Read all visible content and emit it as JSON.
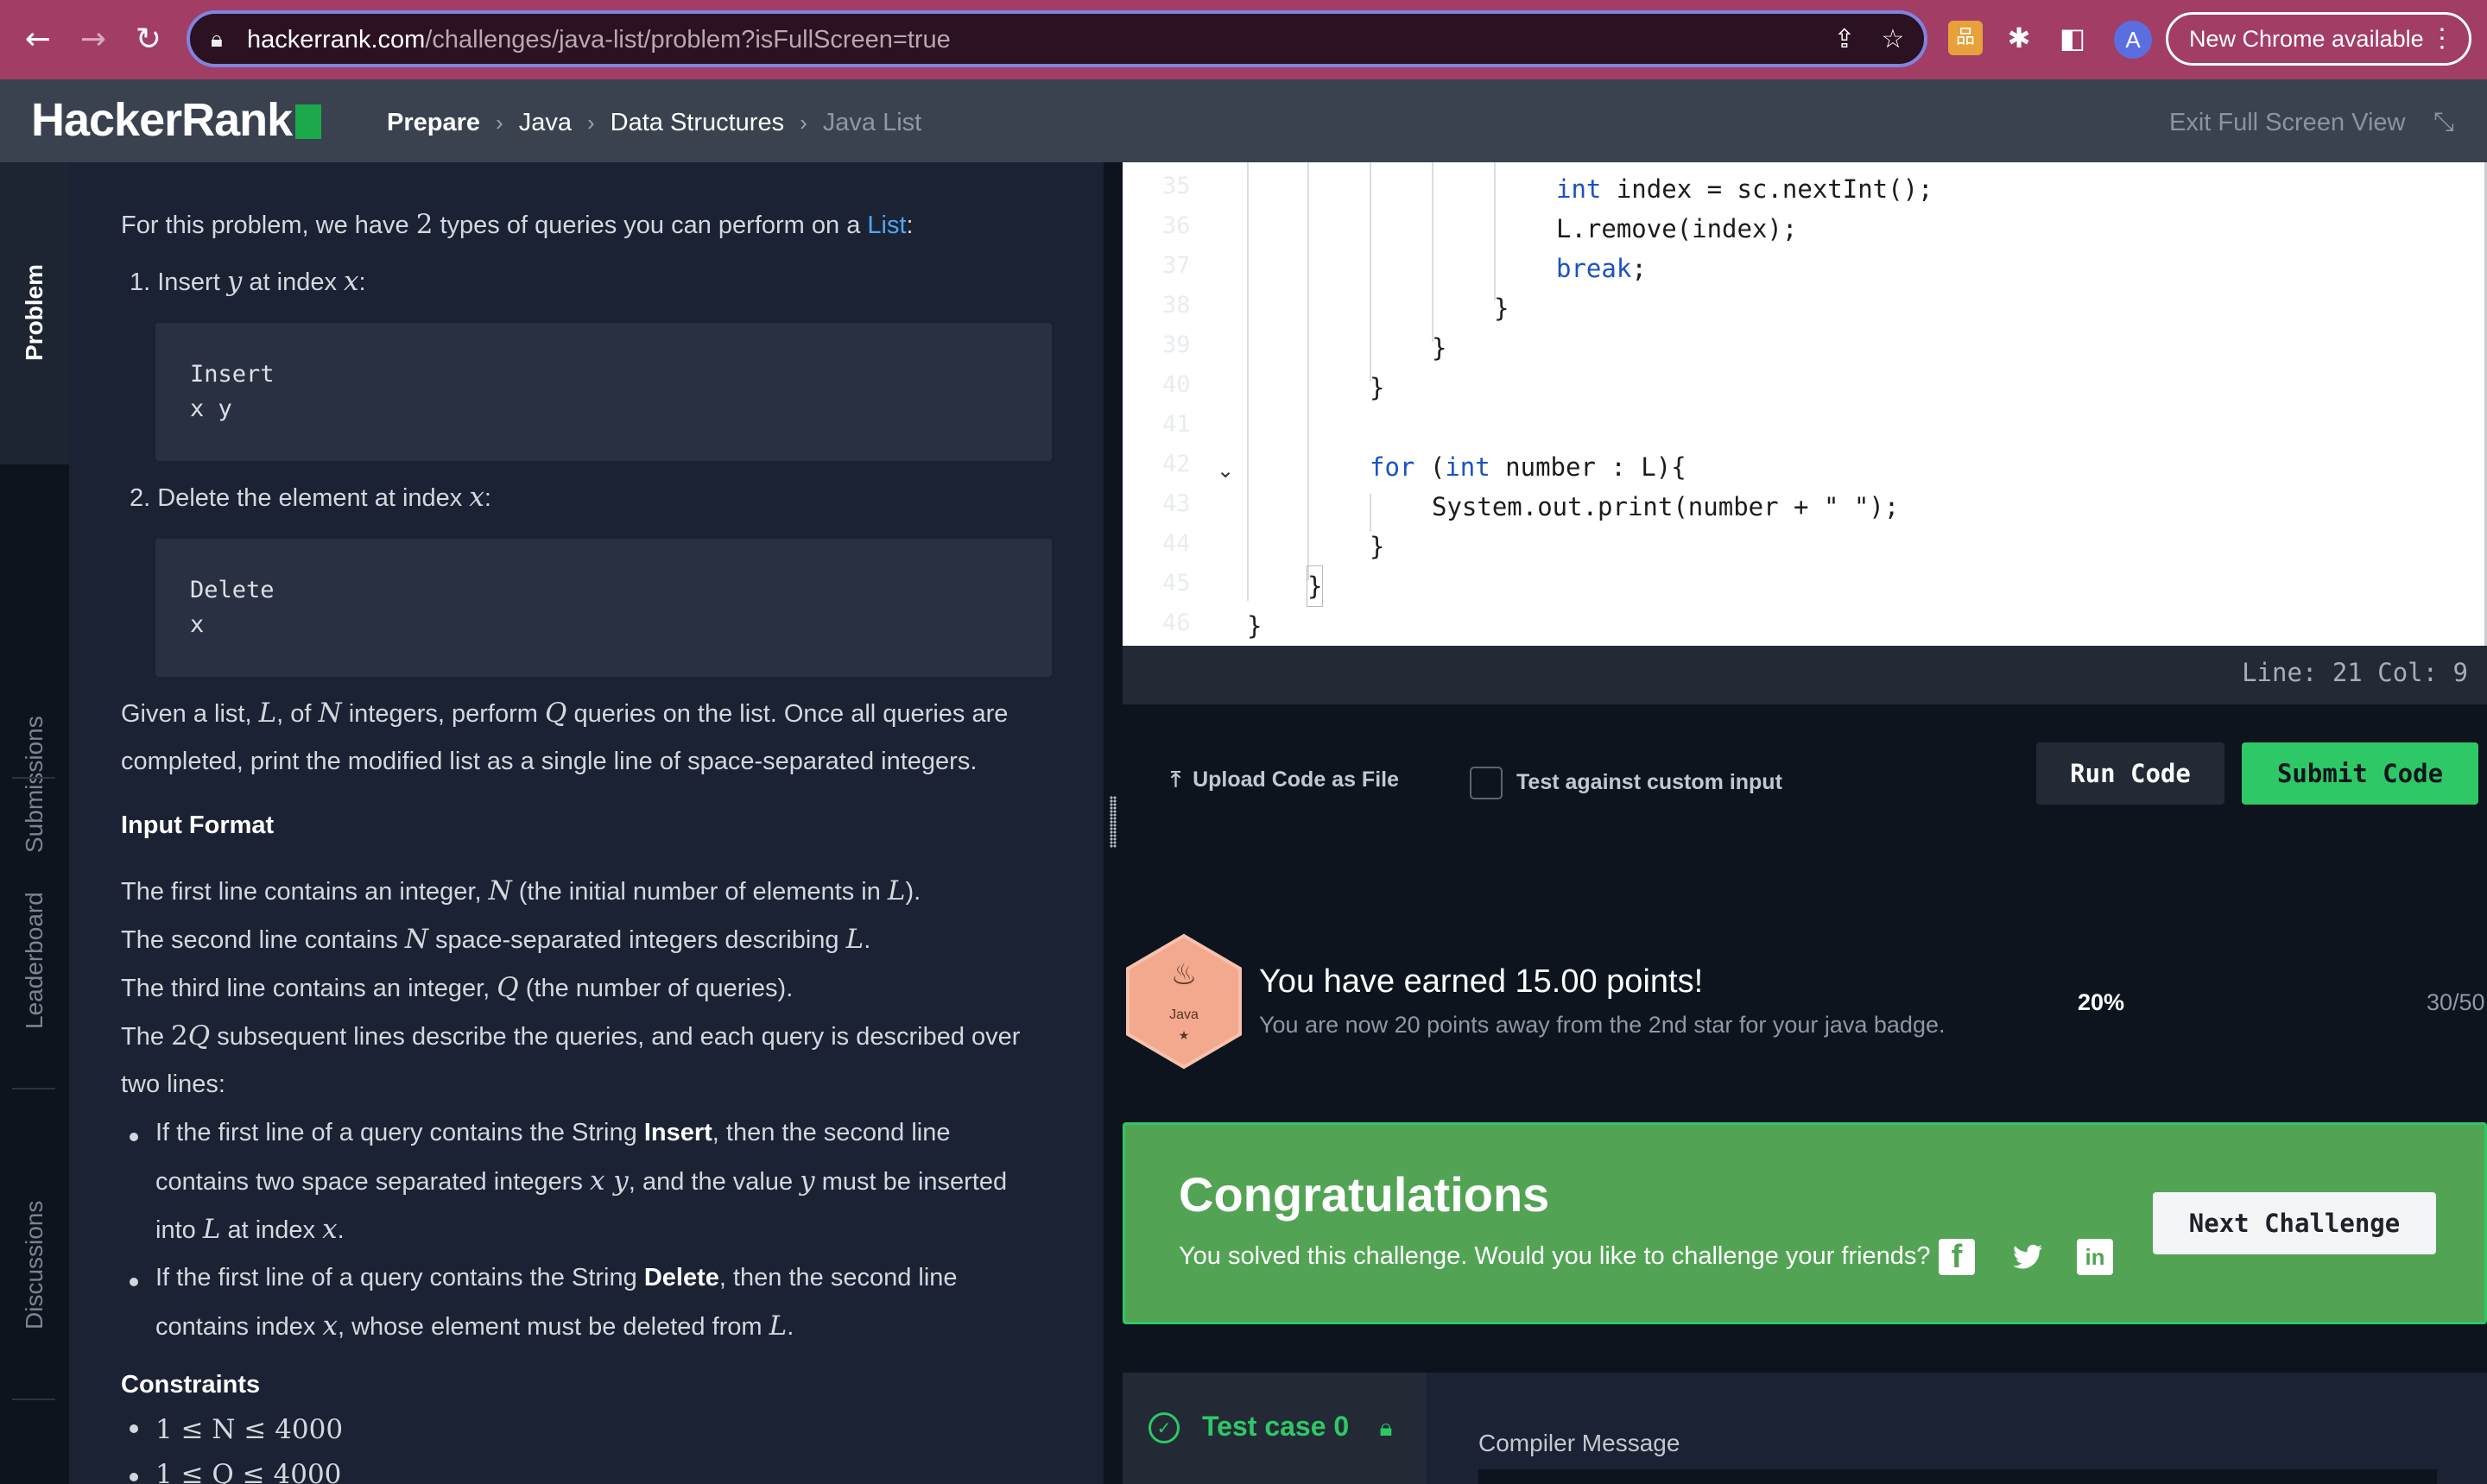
{
  "browser": {
    "url_host": "hackerrank.com",
    "url_path": "/challenges/java-list/problem?isFullScreen=true",
    "avatar_letter": "A",
    "new_chrome_label": "New Chrome available",
    "extension_label": "品",
    "accent_color": "#a23d65"
  },
  "header": {
    "logo": "HackerRank",
    "breadcrumb": [
      "Prepare",
      "Java",
      "Data Structures",
      "Java List"
    ],
    "exit_full_screen": "Exit Full Screen View"
  },
  "vertical_tabs": [
    "Problem",
    "Submissions",
    "Leaderboard",
    "Discussions"
  ],
  "problem": {
    "intro_a": "For this problem, we have ",
    "intro_num": "2",
    "intro_b": " types of queries you can perform on a ",
    "intro_link": "List",
    "intro_c": ":",
    "q1_a": "1. Insert ",
    "q1_var1": "y",
    "q1_b": " at index ",
    "q1_var2": "x",
    "q1_c": ":",
    "code1_line1": "Insert",
    "code1_line2": "x y",
    "q2_a": "2. Delete the element at index ",
    "q2_var": "x",
    "q2_b": ":",
    "code2_line1": "Delete",
    "code2_line2": "x",
    "given_a": "Given a list, ",
    "given_L": "L",
    "given_b": ", of ",
    "given_N": "N",
    "given_c": " integers, perform ",
    "given_Q": "Q",
    "given_d": " queries on the list. Once all queries are",
    "given_line2": "completed, print the modified list as a single line of space-separated integers.",
    "input_format_heading": "Input Format",
    "if1_a": "The first line contains an integer, ",
    "if1_N": "N",
    "if1_b": " (the initial number of elements in ",
    "if1_L": "L",
    "if1_c": ").",
    "if2_a": "The second line contains ",
    "if2_N": "N",
    "if2_b": " space-separated integers describing ",
    "if2_L": "L",
    "if2_c": ".",
    "if3_a": "The third line contains an integer, ",
    "if3_Q": "Q",
    "if3_b": " (the number of queries).",
    "if4_a": "The ",
    "if4_2": "2",
    "if4_Q": "Q",
    "if4_b": " subsequent lines describe the queries, and each query is described over",
    "if4_line2": "two lines:",
    "b1_a": "If the first line of a query contains the String ",
    "b1_bold": "Insert",
    "b1_b": ", then the second line",
    "b1_l2a": "contains two space separated integers ",
    "b1_xy": "x y",
    "b1_l2b": ", and the value ",
    "b1_y": "y",
    "b1_l2c": " must be inserted",
    "b1_l3a": "into ",
    "b1_L": "L",
    "b1_l3b": " at index ",
    "b1_x": "x",
    "b1_l3c": ".",
    "b2_a": "If the first line of a query contains the String ",
    "b2_bold": "Delete",
    "b2_b": ", then the second line",
    "b2_l2a": "contains index ",
    "b2_x": "x",
    "b2_l2b": ", whose element must be deleted from ",
    "b2_L": "L",
    "b2_l2c": ".",
    "constraints_heading": "Constraints",
    "c1": "1 ≤ N ≤ 4000",
    "c2": "1 ≤ Q ≤ 4000"
  },
  "editor": {
    "line_numbers": [
      "35",
      "36",
      "37",
      "38",
      "39",
      "40",
      "41",
      "42",
      "43",
      "44",
      "45",
      "46"
    ],
    "lines": {
      "l35": "int index = sc.nextInt();",
      "l35_kw": "int",
      "l35_rest": " index = sc.nextInt();",
      "l36": "L.remove(index);",
      "l37_kw": "break",
      "l37_rest": ";",
      "l38": "}",
      "l39": "}",
      "l40": "}",
      "l42_kw1": "for",
      "l42_a": " (",
      "l42_kw2": "int",
      "l42_b": " number : L){",
      "l43": "System.out.print(number + \" \");",
      "l44": "}",
      "l45": "}",
      "l46": "}"
    },
    "cursor_position": "Line: 21 Col: 9"
  },
  "actions": {
    "upload_label": "Upload Code as File",
    "custom_input_label": "Test against custom input",
    "run_label": "Run Code",
    "submit_label": "Submit Code"
  },
  "points": {
    "badge_label": "Java",
    "title": "You have earned 15.00 points!",
    "subtitle": "You are now 20 points away from the 2nd star for your java badge.",
    "percent": "20%",
    "fraction": "30/50"
  },
  "congrats": {
    "title": "Congratulations",
    "subtitle": "You solved this challenge. Would you like to challenge your friends?",
    "next_label": "Next Challenge"
  },
  "tests": {
    "test_case_label": "Test case 0",
    "compiler_message_label": "Compiler Message"
  }
}
